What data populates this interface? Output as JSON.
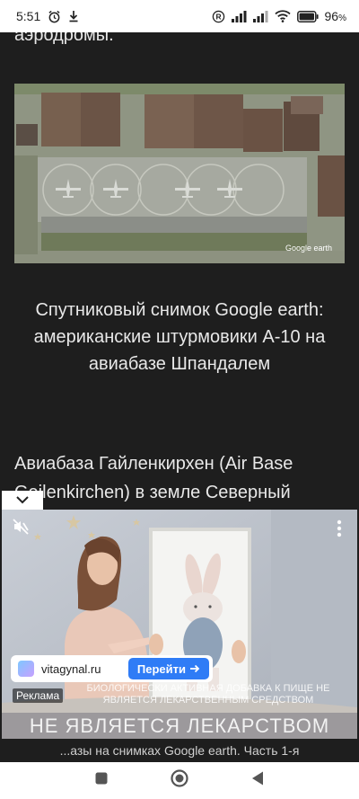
{
  "status_bar": {
    "time": "5:51",
    "battery": "96",
    "battery_unit": "%"
  },
  "article": {
    "top_text": "аэродромы.",
    "photo_watermark": "Google earth",
    "photo_caption": "Спутниковый снимок Google earth: американские штурмовики A-10 на авиабазе Шпандалем",
    "paragraph": "Авиабаза Гайленкирхен (Air Base Geilenkirchen) в земле Северный"
  },
  "ad": {
    "domain": "vitagynal.ru",
    "go_button": "Перейти",
    "label": "Реклама",
    "disclaimer_small": "Биологически активная добавка к пище не является лекарственным средством",
    "disclaimer_big": "НЕ ЯВЛЯЕТСЯ ЛЕКАРСТВОМ"
  },
  "footer_caption": "...азы на снимках Google earth. Часть 1-я",
  "icons": [
    "alarm-icon",
    "download-icon",
    "registered-icon",
    "signal-icon",
    "wifi-icon",
    "battery-icon",
    "chevron-down-icon",
    "mute-icon",
    "more-vertical-icon",
    "arrow-right-icon",
    "recents-icon",
    "home-icon",
    "back-icon"
  ]
}
